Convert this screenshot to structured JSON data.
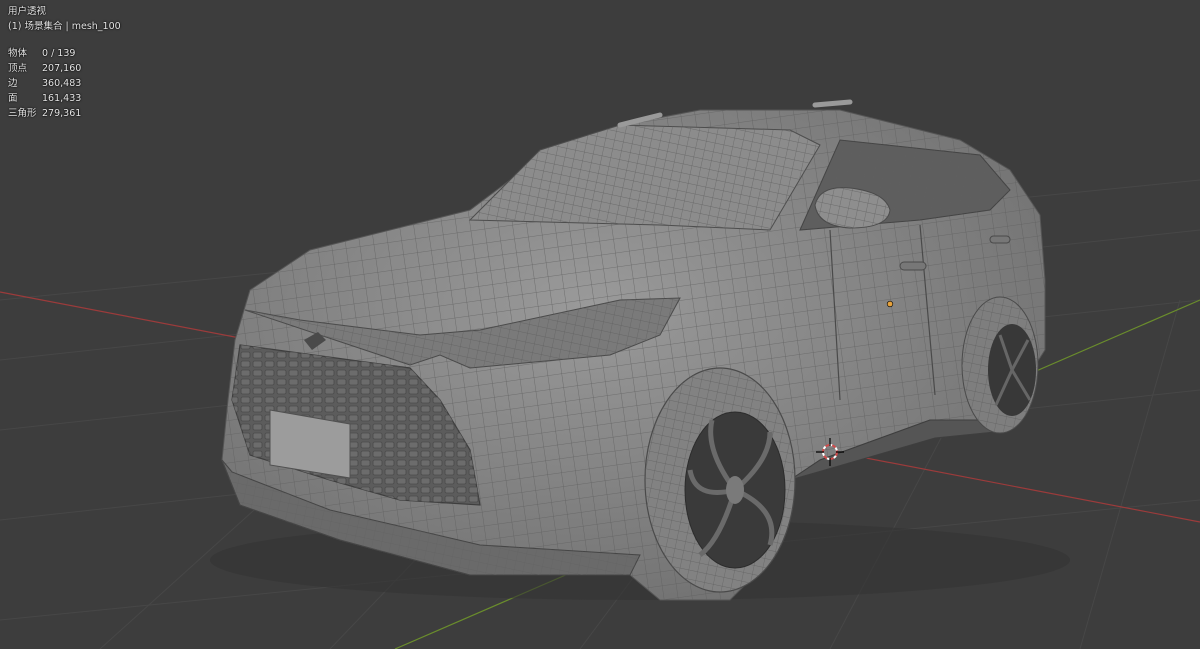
{
  "viewport": {
    "view_name": "用户透视",
    "collection_line": "(1) 场景集合 | mesh_100",
    "stats": [
      {
        "label": "物体",
        "value": "0 / 139"
      },
      {
        "label": "顶点",
        "value": "207,160"
      },
      {
        "label": "边",
        "value": "360,483"
      },
      {
        "label": "面",
        "value": "161,433"
      },
      {
        "label": "三角形",
        "value": "279,361"
      }
    ]
  },
  "colors": {
    "background": "#3d3d3d",
    "grid_line": "#4a4a4a",
    "x_axis": "#a33a3a",
    "y_axis": "#6e8f2e",
    "mesh_body": "#8a8a8a",
    "mesh_wire": "#5a5a5a",
    "origin_dot": "#e6a23c"
  },
  "icons": {
    "cursor": "3d-cursor-icon",
    "origin": "object-origin-icon"
  }
}
